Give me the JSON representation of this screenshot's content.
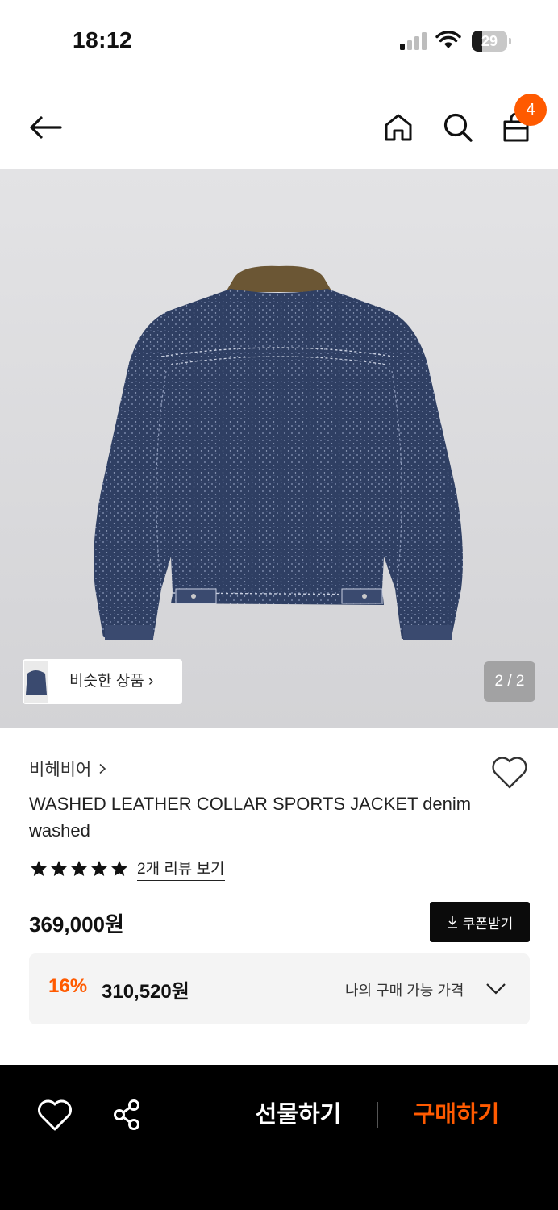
{
  "status_bar": {
    "time": "18:12",
    "battery": "29",
    "battery_level_percent": 29
  },
  "header": {
    "cart_count": "4",
    "badge_color": "#ff5a00"
  },
  "hero": {
    "similar_label": "비슷한 상품",
    "page_indicator": "2 / 2"
  },
  "product": {
    "brand": "비헤비어",
    "title": "WASHED LEATHER COLLAR SPORTS JACKET denim washed",
    "rating_stars": 5,
    "review_link": "2개 리뷰 보기",
    "price": "369,000원",
    "coupon_label": "쿠폰받기",
    "discount_rate": "16%",
    "discount_price": "310,520원",
    "my_price_label": "나의 구매 가능 가격"
  },
  "bottom_bar": {
    "gift_label": "선물하기",
    "buy_label": "구매하기",
    "accent_color": "#ff5a00"
  }
}
